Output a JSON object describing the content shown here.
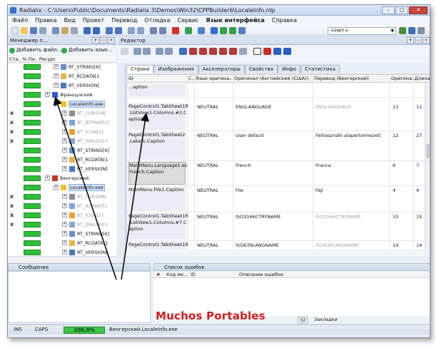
{
  "window": {
    "title": "Radialix - C:\\Users\\Public\\Documents\\Radialix 3\\Demos\\Win32\\CPPBuilder6\\LocaleInfo.rdp",
    "min": "–",
    "max": "□",
    "close": "✕"
  },
  "menu": [
    "Файл",
    "Правка",
    "Вид",
    "Проект",
    "Перевод",
    "Отладка",
    "Сервис",
    "Язык интерфейса",
    "Справка"
  ],
  "toolbar": {
    "combo": "<Нет>"
  },
  "project_manager": {
    "title": "Менеджер п...",
    "add_file": "Добавить файл...",
    "add_lang": "Добавить язык...",
    "columns": "Ста.. % Пе.. Ресурс"
  },
  "tree": [
    {
      "mark": "",
      "bar": 1,
      "icon": "doc",
      "label": "RT_STRING[6]",
      "indent": 1,
      "gray": false
    },
    {
      "mark": "",
      "bar": 1,
      "icon": "folder",
      "label": "RT_RCDATA[1",
      "indent": 1,
      "gray": false
    },
    {
      "mark": "",
      "bar": 1,
      "icon": "gear",
      "label": "RT_VERSION[",
      "indent": 1,
      "gray": false
    },
    {
      "mark": "",
      "bar": 1,
      "icon": "flag-fr",
      "label": "Французский",
      "indent": 0,
      "gray": false
    },
    {
      "mark": "",
      "bar": 1,
      "icon": "warn",
      "label": "LocaleInfo.exe",
      "indent": 1,
      "gray": false,
      "sel": true
    },
    {
      "mark": "X",
      "bar": 1,
      "icon": "cursor",
      "label": "RT_CURSOR[",
      "indent": 2,
      "gray": true
    },
    {
      "mark": "X",
      "bar": 1,
      "icon": "bitmap",
      "label": "RT_BITMAP[2]",
      "indent": 2,
      "gray": true
    },
    {
      "mark": "X",
      "bar": 1,
      "icon": "icon",
      "label": "RT_ICON[2]",
      "indent": 2,
      "gray": true
    },
    {
      "mark": "X",
      "bar": 1,
      "icon": "dialog",
      "label": "RT_DIALOG[3",
      "indent": 2,
      "gray": true
    },
    {
      "mark": "",
      "bar": 1,
      "icon": "doc",
      "label": "RT_STRING[6]",
      "indent": 2,
      "gray": false
    },
    {
      "mark": "",
      "bar": 1,
      "icon": "folder",
      "label": "RT_RCDATA[1",
      "indent": 2,
      "gray": false
    },
    {
      "mark": "",
      "bar": 1,
      "icon": "gear",
      "label": "RT_VERSION[",
      "indent": 2,
      "gray": false
    },
    {
      "mark": "",
      "bar": 1,
      "icon": "flag-hu",
      "label": "Венгерский",
      "indent": 0,
      "gray": false
    },
    {
      "mark": "",
      "bar": 1,
      "icon": "warn",
      "label": "LocaleInfo.exe",
      "indent": 1,
      "gray": false,
      "sel": true
    },
    {
      "mark": "X",
      "bar": 1,
      "icon": "cursor",
      "label": "RT_CURSOR[",
      "indent": 2,
      "gray": true
    },
    {
      "mark": "X",
      "bar": 1,
      "icon": "bitmap",
      "label": "RT_BITMAP[2",
      "indent": 2,
      "gray": true
    },
    {
      "mark": "X",
      "bar": 1,
      "icon": "icon",
      "label": "RT_ICON[2]",
      "indent": 2,
      "gray": true
    },
    {
      "mark": "X",
      "bar": 1,
      "icon": "dialog",
      "label": "RT_DIALOG[3",
      "indent": 2,
      "gray": true
    },
    {
      "mark": "",
      "bar": 1,
      "icon": "doc",
      "label": "RT_STRING[6]",
      "indent": 2,
      "gray": false
    },
    {
      "mark": "",
      "bar": 1,
      "icon": "folder",
      "label": "RT_RCDATA[1",
      "indent": 2,
      "gray": false
    },
    {
      "mark": "",
      "bar": 1,
      "icon": "gear",
      "label": "RT_VERSION[",
      "indent": 2,
      "gray": false
    }
  ],
  "editor": {
    "title": "Редактор",
    "tabs": [
      "Строки",
      "Изображения",
      "Акселераторы",
      "Свойства",
      "Инфо",
      "Статистика"
    ],
    "columns": [
      "ID",
      "С..",
      "Язык оригина..",
      "Оригинал (Английский (США))",
      "Перевод (Венгерский)",
      "Оригина..",
      "Длина"
    ],
    "rows": [
      {
        "id": "...aption",
        "lang": "",
        "orig": "",
        "trans": "",
        "ol": "",
        "len": "",
        "muted": false
      },
      {
        "id": "PageControl1.TabSheet1R\n.ListView1.Columns.#2.C\naption",
        "lang": "NEUTRAL",
        "orig": "ENGLANGUAGE",
        "trans": "ENGLANGUAGE",
        "ol": "11",
        "len": "11",
        "muted": true
      },
      {
        "id": "PageControl1.TabSheet2\n.Label1.Caption",
        "lang": "NEUTRAL",
        "orig": "User default",
        "trans": "Felhasználó alapértelmezett",
        "ol": "12",
        "len": "27",
        "muted": false
      },
      {
        "id": "MainMenu.Language1.es\nFrench.Caption",
        "lang": "NEUTRAL",
        "orig": "French",
        "trans": "Franca",
        "ol": "6",
        "len": "7",
        "muted": false,
        "sel": true
      },
      {
        "id": "MainMenu.File1.Caption",
        "lang": "NEUTRAL",
        "orig": "File",
        "trans": "Fájl",
        "ol": "4",
        "len": "4",
        "muted": false
      },
      {
        "id": "PageControl1.TabSheet1R\n.ListView1.Columns.#7.C\naption",
        "lang": "NEUTRAL",
        "orig": "ISO3166CTRYNAME",
        "trans": "ISO3166CTRYNAME",
        "ol": "15",
        "len": "15",
        "muted": true
      },
      {
        "id": "PageControl1.TabSheet1R",
        "lang": "NEUTRAL",
        "orig": "ISO639LANGNAME",
        "trans": "ISO639LANGNAME",
        "ol": "14",
        "len": "14",
        "muted": true
      }
    ]
  },
  "messages": {
    "title": "Сообщения"
  },
  "errors": {
    "title": "Список ошибок",
    "columns": [
      "#",
      "Код ям...",
      "ID",
      "Описание ошибки"
    ],
    "tab_bookmarks": "Закладки",
    "tab_x": "32"
  },
  "status": {
    "ins": "INS",
    "caps": "CAPS",
    "progress_text": "100,0%",
    "progress_value": 1.0,
    "file": "Венгерский.LocaleInfo.exe"
  },
  "watermark": "Muchos Portables",
  "colors": {
    "accent": "#2fbe3b",
    "title_bg": "#c4d5ec",
    "watermark": "#d21d1d"
  }
}
